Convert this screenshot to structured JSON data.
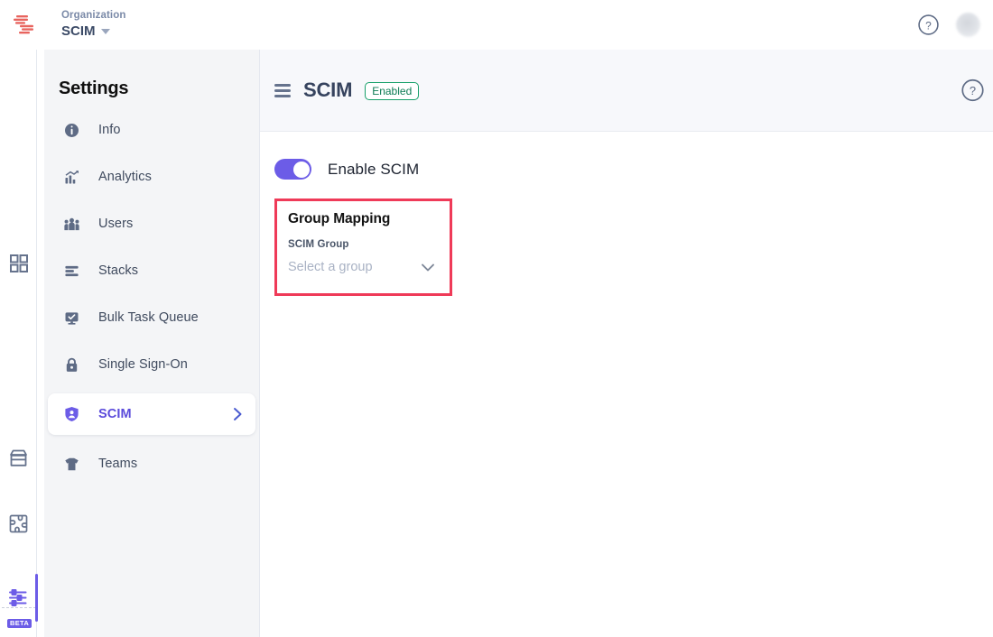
{
  "topbar": {
    "logo_icon": "striped-s-logo-icon",
    "org_label": "Organization",
    "org_name": "SCIM",
    "caret_icon": "caret-down-icon",
    "help_icon": "help-circle-icon",
    "avatar_icon": "user-avatar"
  },
  "rail": {
    "items": [
      {
        "icon": "grid-apps-icon",
        "name": "apps"
      },
      {
        "icon": "storefront-icon",
        "name": "marketplace"
      },
      {
        "icon": "puzzle-piece-icon",
        "name": "integrations"
      },
      {
        "icon": "sliders-settings-icon",
        "name": "settings"
      }
    ],
    "beta_badge": "BETA",
    "active_index": 3
  },
  "sidebar": {
    "title": "Settings",
    "items": [
      {
        "label": "Info",
        "icon": "info-circle-icon",
        "active": false
      },
      {
        "label": "Analytics",
        "icon": "analytics-chart-icon",
        "active": false
      },
      {
        "label": "Users",
        "icon": "users-group-icon",
        "active": false
      },
      {
        "label": "Stacks",
        "icon": "stacks-layers-icon",
        "active": false
      },
      {
        "label": "Bulk Task Queue",
        "icon": "monitor-check-icon",
        "active": false
      },
      {
        "label": "Single Sign-On",
        "icon": "lock-icon",
        "active": false
      },
      {
        "label": "SCIM",
        "icon": "shield-user-icon",
        "active": true
      },
      {
        "label": "Teams",
        "icon": "tshirt-icon",
        "active": false
      }
    ],
    "active_chevron_icon": "chevron-right-icon"
  },
  "main": {
    "menu_icon": "hamburger-menu-icon",
    "title": "SCIM",
    "status_badge": "Enabled",
    "help_icon": "help-circle-icon",
    "toggle": {
      "label": "Enable SCIM",
      "state": "on"
    },
    "group_mapping": {
      "title": "Group Mapping",
      "field_label": "SCIM Group",
      "select_placeholder": "Select a group",
      "select_value": "",
      "chevron_icon": "chevron-down-icon",
      "highlighted": true
    }
  },
  "colors": {
    "accent_purple": "#6c5ce7",
    "active_text_purple": "#5b4bdb",
    "highlight_red": "#ef3a58",
    "badge_green": "#17a06a",
    "sidebar_bg": "#f4f5f7",
    "panel_head_bg": "#f7f8fb",
    "logo_red": "#e8645e"
  }
}
